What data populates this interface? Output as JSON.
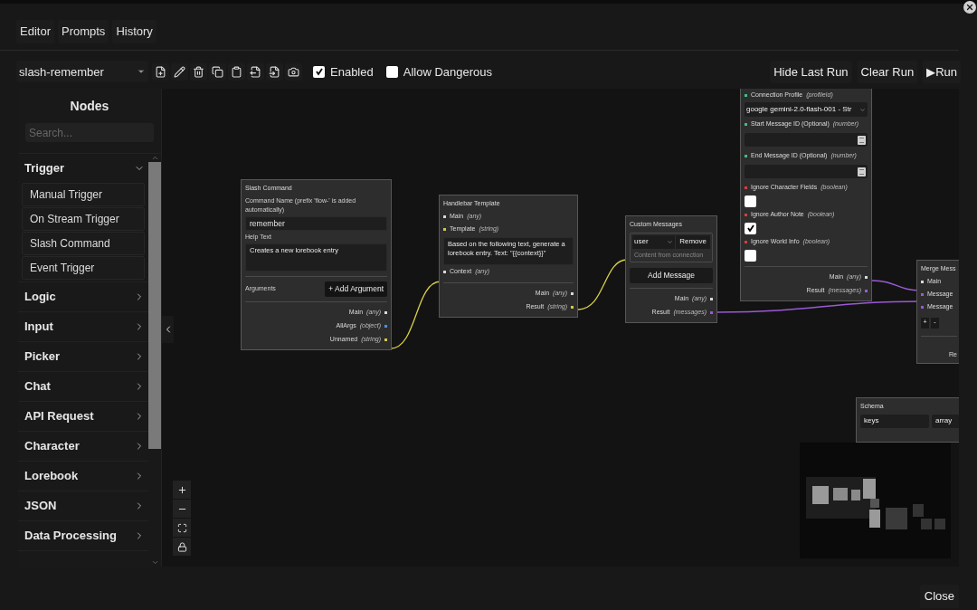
{
  "tabs": [
    {
      "label": "Editor"
    },
    {
      "label": "Prompts"
    },
    {
      "label": "History"
    }
  ],
  "toolbar": {
    "flow_select": "slash-remember",
    "enabled": {
      "label": "Enabled",
      "checked": true
    },
    "allow_dangerous": {
      "label": "Allow Dangerous",
      "checked": false
    },
    "buttons": [
      "Hide Last Run",
      "Clear Run",
      "▶Run"
    ]
  },
  "sidebar": {
    "title": "Nodes",
    "search": {
      "placeholder": "Search..."
    },
    "categories": [
      {
        "label": "Trigger",
        "expanded": true,
        "children": [
          {
            "label": "Manual Trigger"
          },
          {
            "label": "On Stream Trigger"
          },
          {
            "label": "Slash Command"
          },
          {
            "label": "Event Trigger"
          }
        ]
      },
      {
        "label": "Logic",
        "expanded": false
      },
      {
        "label": "Input",
        "expanded": false
      },
      {
        "label": "Picker",
        "expanded": false
      },
      {
        "label": "Chat",
        "expanded": false
      },
      {
        "label": "API Request",
        "expanded": false
      },
      {
        "label": "Character",
        "expanded": false
      },
      {
        "label": "Lorebook",
        "expanded": false
      },
      {
        "label": "JSON",
        "expanded": false
      },
      {
        "label": "Data Processing",
        "expanded": false
      }
    ]
  },
  "nodes": [
    {
      "title": "Slash Command",
      "rows": [
        {
          "kind": "label",
          "text": "Command Name (prefix 'flow-' is added automatically)"
        },
        {
          "kind": "input",
          "value": "remember"
        },
        {
          "kind": "label",
          "text": "Help Text"
        },
        {
          "kind": "textarea",
          "value": "Creates a new lorebook entry"
        },
        {
          "kind": "divider"
        },
        {
          "kind": "labeled_button",
          "label": "Arguments",
          "button": "+ Add Argument"
        },
        {
          "kind": "divider"
        },
        {
          "kind": "port_out",
          "label": "Main",
          "type": "(any)",
          "color": "#d9d9d9"
        },
        {
          "kind": "port_out",
          "label": "AllArgs",
          "type": "(object)",
          "color": "#4a90e2"
        },
        {
          "kind": "port_out",
          "label": "Unnamed",
          "type": "(string)",
          "color": "#d4c84a"
        }
      ]
    },
    {
      "title": "Handlebar Template",
      "rows": [
        {
          "kind": "port_in",
          "label": "Main",
          "type": "(any)",
          "color": "#d9d9d9"
        },
        {
          "kind": "port_in",
          "label": "Template",
          "type": "(string)",
          "color": "#d4c84a"
        },
        {
          "kind": "textarea",
          "value": "Based on the following text, generate a lorebook entry. Text: \"{{context}}\""
        },
        {
          "kind": "port_in",
          "label": "Context",
          "type": "(any)",
          "color": "#d9d9d9"
        },
        {
          "kind": "divider"
        },
        {
          "kind": "port_out",
          "label": "Main",
          "type": "(any)",
          "color": "#d9d9d9"
        },
        {
          "kind": "port_out",
          "label": "Result",
          "type": "(string)",
          "color": "#d4c84a"
        }
      ]
    },
    {
      "title": "Custom Messages",
      "rows": [
        {
          "kind": "message",
          "role": "user",
          "button": "Remove",
          "hint": "Content from connection"
        },
        {
          "kind": "button",
          "text": "Add Message"
        },
        {
          "kind": "divider"
        },
        {
          "kind": "port_out",
          "label": "Main",
          "type": "(any)",
          "color": "#d9d9d9"
        },
        {
          "kind": "port_out",
          "label": "Result",
          "type": "(messages)",
          "color": "#9b59d6"
        }
      ]
    },
    {
      "rows": [
        {
          "kind": "port_in",
          "label": "Connection Profile",
          "type": "(profileId)",
          "color": "#3fbf7f"
        },
        {
          "kind": "select",
          "value": "google gemini-2.0-flash-001 - Str"
        },
        {
          "kind": "port_in",
          "label": "Start Message ID (Optional)",
          "type": "(number)",
          "color": "#3fbf7f"
        },
        {
          "kind": "number"
        },
        {
          "kind": "port_in",
          "label": "End Message ID (Optional)",
          "type": "(number)",
          "color": "#3fbf7f"
        },
        {
          "kind": "number"
        },
        {
          "kind": "port_in",
          "label": "Ignore Character Fields",
          "type": "(boolean)",
          "color": "#d04040"
        },
        {
          "kind": "checkbox",
          "checked": false
        },
        {
          "kind": "port_in",
          "label": "Ignore Author Note",
          "type": "(boolean)",
          "color": "#d04040"
        },
        {
          "kind": "checkbox",
          "checked": true
        },
        {
          "kind": "port_in",
          "label": "Ignore World Info",
          "type": "(boolean)",
          "color": "#d04040"
        },
        {
          "kind": "checkbox",
          "checked": false
        },
        {
          "kind": "divider"
        },
        {
          "kind": "port_out",
          "label": "Main",
          "type": "(any)",
          "color": "#d9d9d9"
        },
        {
          "kind": "port_out",
          "label": "Result",
          "type": "(messages)",
          "color": "#9b59d6"
        }
      ]
    },
    {
      "title": "Merge Mess",
      "rows": [
        {
          "kind": "port_in",
          "label": "Main",
          "color": "#d9d9d9"
        },
        {
          "kind": "port_in",
          "label": "Message",
          "color": "#9b59d6"
        },
        {
          "kind": "port_in",
          "label": "Message",
          "color": "#9b59d6"
        },
        {
          "kind": "plusminus",
          "buttons": [
            "+",
            "-"
          ]
        },
        {
          "kind": "divider"
        },
        {
          "kind": "text",
          "text": "Re"
        }
      ]
    },
    {
      "title": "Schema",
      "rows": [
        {
          "kind": "pair",
          "values": [
            "keys",
            "array"
          ]
        }
      ]
    }
  ],
  "footer": {
    "close": "Close"
  }
}
